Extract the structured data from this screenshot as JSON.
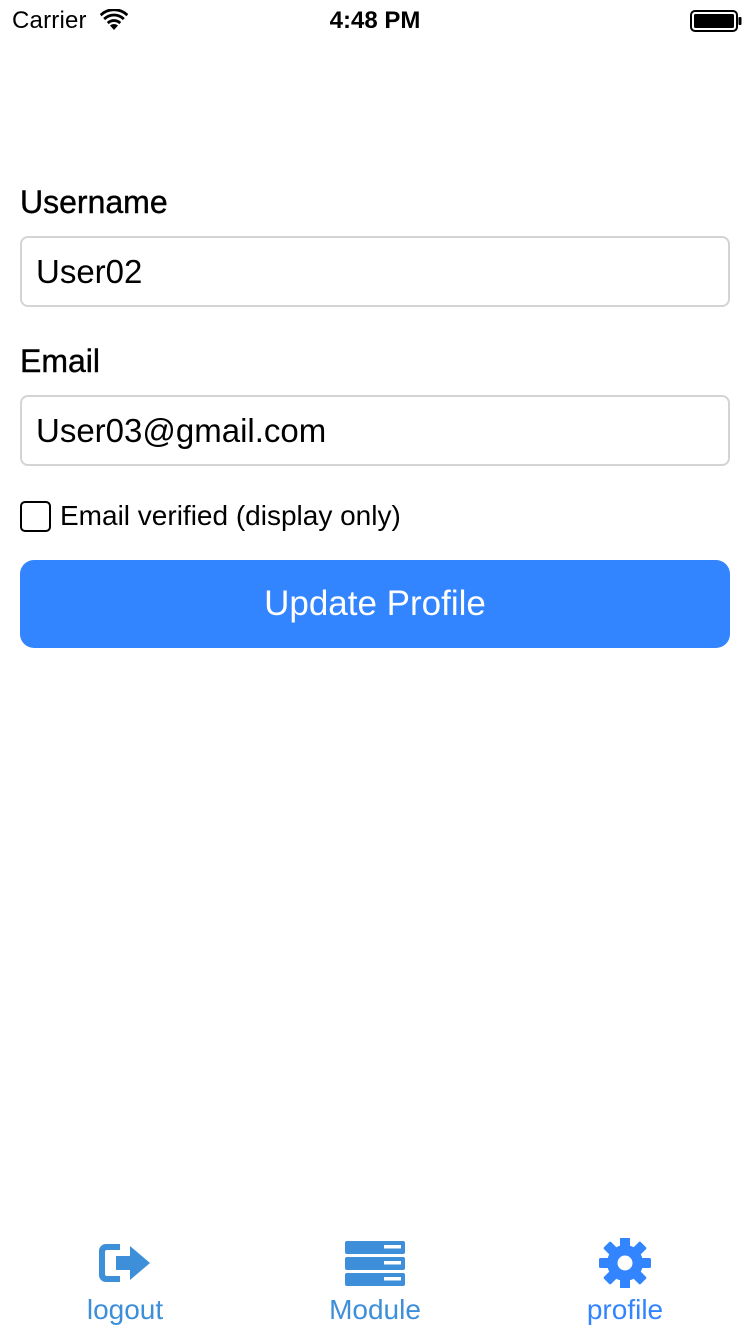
{
  "status_bar": {
    "carrier": "Carrier",
    "time": "4:48 PM",
    "icons": [
      "wifi-icon",
      "battery-icon"
    ]
  },
  "form": {
    "username_label": "Username",
    "username_value": "User02",
    "email_label": "Email",
    "email_value": "User03@gmail.com",
    "email_verified_label": "Email verified (display only)",
    "email_verified_checked": false,
    "update_button_label": "Update Profile"
  },
  "tab_bar": {
    "tabs": [
      {
        "label": "logout",
        "icon": "logout-icon"
      },
      {
        "label": "Module",
        "icon": "module-icon"
      },
      {
        "label": "profile",
        "icon": "gear-icon",
        "active": true
      }
    ]
  },
  "colors": {
    "accent": "#3385ff",
    "tab_icon": "#3d8fd9",
    "input_border": "#d4d4d4"
  }
}
